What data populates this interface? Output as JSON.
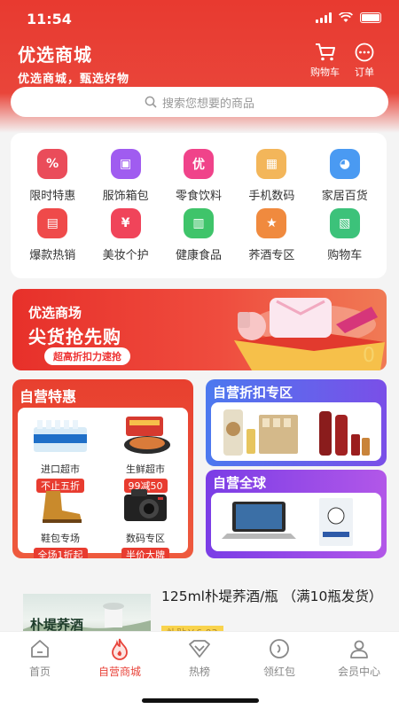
{
  "status_bar": {
    "time": "11:54"
  },
  "header": {
    "title": "优选商城",
    "subtitle": "优选商城，甄选好物",
    "cart_label": "购物车",
    "orders_label": "订单"
  },
  "search": {
    "placeholder": "搜索您想要的商品"
  },
  "categories": [
    {
      "label": "限时特惠",
      "icon": "discount-icon",
      "color": "#ea4c5a",
      "glyph": "%"
    },
    {
      "label": "服饰箱包",
      "icon": "bag-icon",
      "color": "#a05cf0",
      "glyph": "▣"
    },
    {
      "label": "零食饮料",
      "icon": "snack-icon",
      "color": "#f0438a",
      "glyph": "优"
    },
    {
      "label": "手机数码",
      "icon": "box-icon",
      "color": "#f3b65a",
      "glyph": "▦"
    },
    {
      "label": "家居百货",
      "icon": "home-goods-icon",
      "color": "#4a9af2",
      "glyph": "◕"
    },
    {
      "label": "爆款热销",
      "icon": "hot-sale-icon",
      "color": "#ef4a4a",
      "glyph": "▤"
    },
    {
      "label": "美妆个护",
      "icon": "money-bag-icon",
      "color": "#f0445a",
      "glyph": "¥"
    },
    {
      "label": "健康食品",
      "icon": "basket-icon",
      "color": "#3fc46a",
      "glyph": "▥"
    },
    {
      "label": "荞酒专区",
      "icon": "medal-icon",
      "color": "#f08a3e",
      "glyph": "★"
    },
    {
      "label": "购物车",
      "icon": "cart-icon",
      "color": "#3cc27a",
      "glyph": "▧"
    }
  ],
  "banner": {
    "line1": "优选商场",
    "line2": "尖货抢先购",
    "pill": "超高折扣力速抢"
  },
  "self_deals": {
    "title": "自营特惠",
    "products": [
      {
        "name": "进口超市",
        "tag": "不止五折"
      },
      {
        "name": "生鲜超市",
        "tag": "99减50"
      },
      {
        "name": "鞋包专场",
        "tag": "全场1折起"
      },
      {
        "name": "数码专区",
        "tag": "半价大牌"
      }
    ]
  },
  "discount_zone": {
    "title": "自营折扣专区"
  },
  "global_zone": {
    "title": "自营全球"
  },
  "featured_item": {
    "name": "125ml朴堤荞酒/瓶 （满10瓶发货）",
    "image_caption": "朴堤荞酒",
    "sub_tag": "补贴￥6.03"
  },
  "tabbar": {
    "items": [
      {
        "label": "首页",
        "icon": "home-icon"
      },
      {
        "label": "自营商城",
        "icon": "flame-icon",
        "active": true
      },
      {
        "label": "热榜",
        "icon": "ranking-icon"
      },
      {
        "label": "领红包",
        "icon": "red-packet-icon"
      },
      {
        "label": "会员中心",
        "icon": "profile-icon"
      }
    ]
  }
}
